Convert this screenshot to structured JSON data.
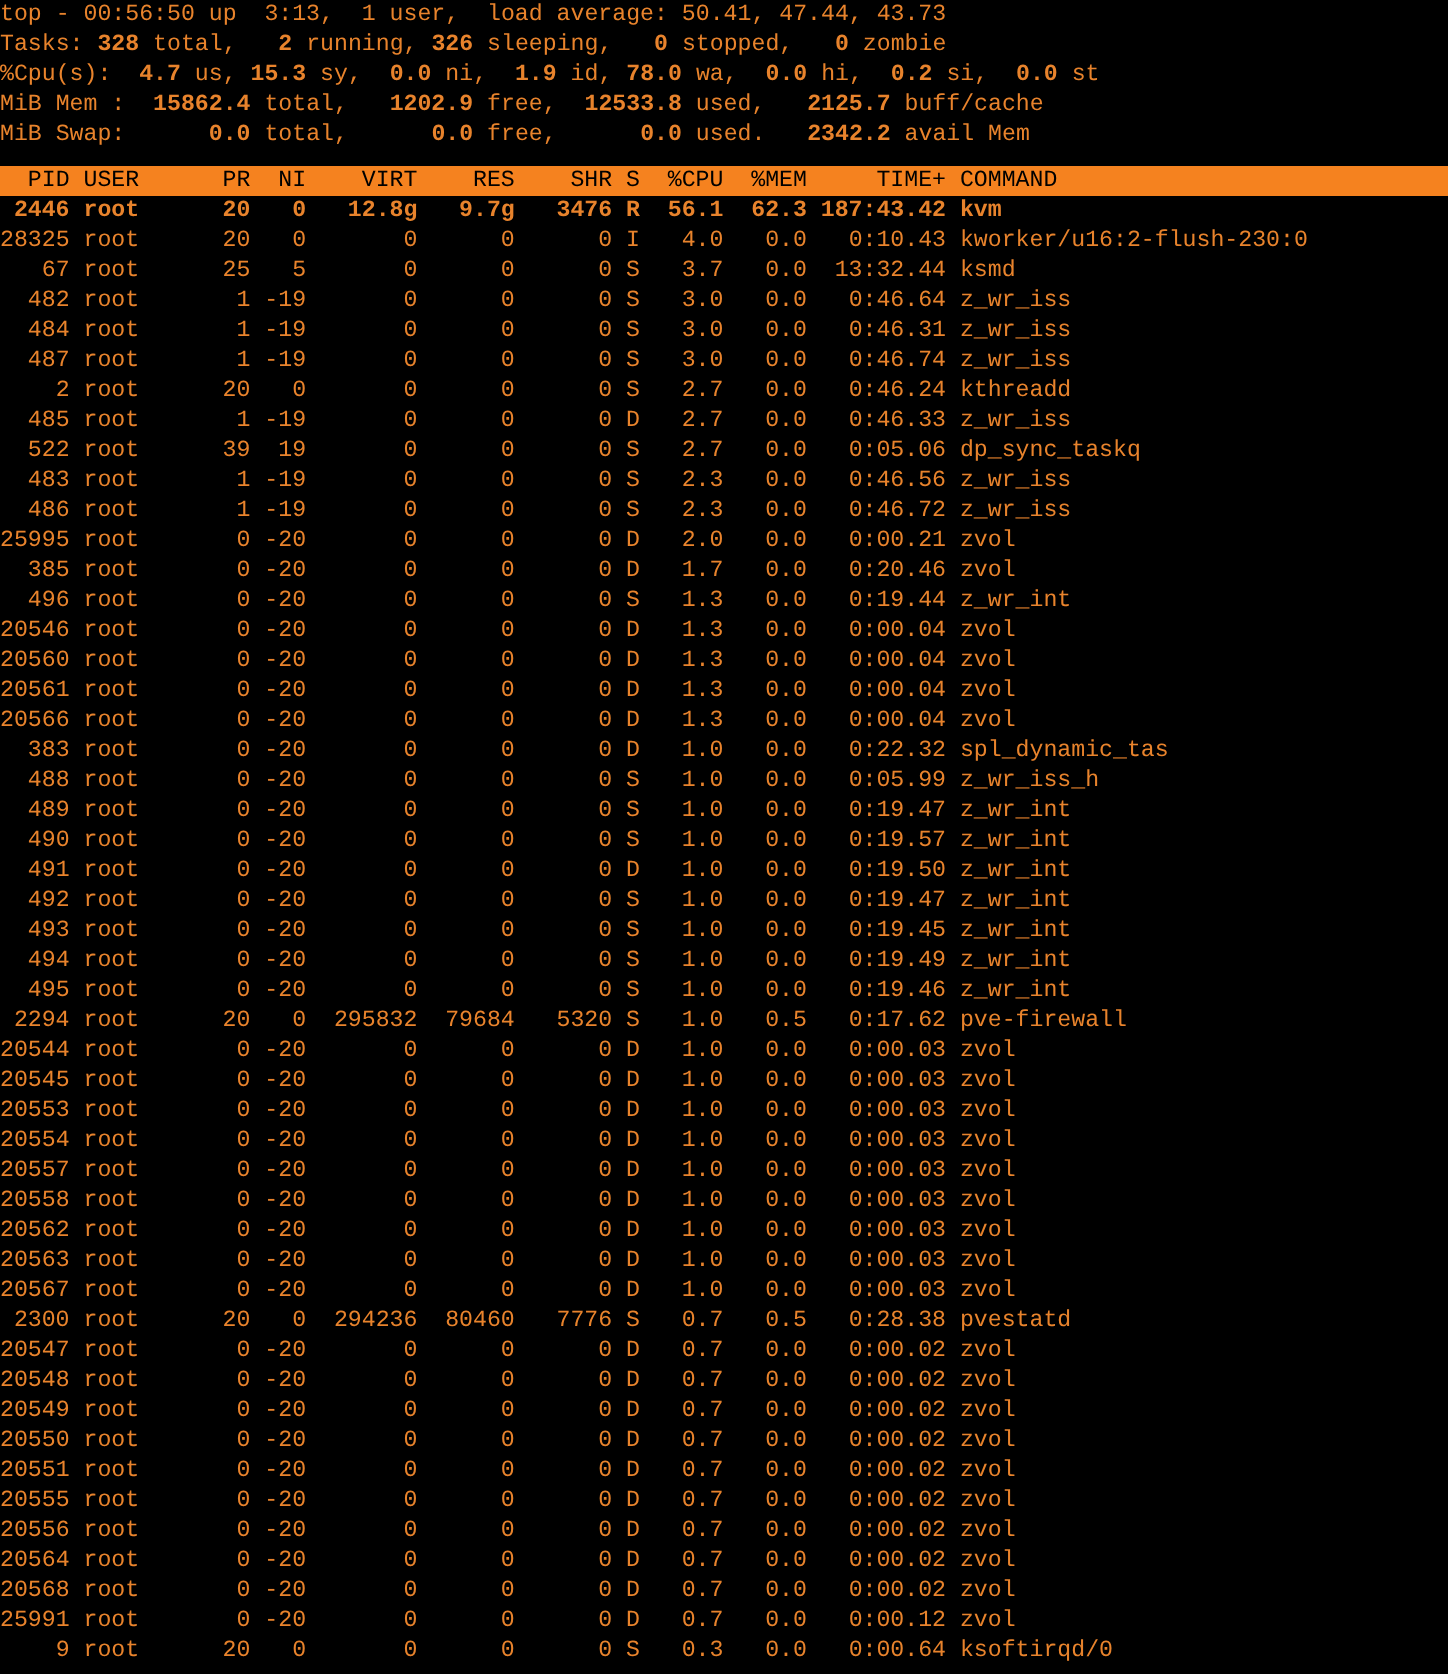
{
  "summary": [
    "top - 00:56:50 up  3:13,  1 user,  load average: 50.41, 47.44, 43.73",
    "Tasks: **328** total,   **2** running, **326** sleeping,   **0** stopped,   **0** zombie",
    "%Cpu(s):  **4.7** us, **15.3** sy,  **0.0** ni,  **1.9** id, **78.0** wa,  **0.0** hi,  **0.2** si,  **0.0** st",
    "MiB Mem :  **15862.4** total,   **1202.9** free,  **12533.8** used,   **2125.7** buff/cache",
    "MiB Swap:      **0.0** total,      **0.0** free,      **0.0** used.   **2342.2** avail Mem"
  ],
  "table": {
    "columns": [
      "PID",
      "USER",
      "PR",
      "NI",
      "VIRT",
      "RES",
      "SHR",
      "S",
      "%CPU",
      "%MEM",
      "TIME+",
      "COMMAND"
    ],
    "rows": [
      {
        "highlighted": true,
        "cells": [
          "2446",
          "root",
          "20",
          "0",
          "12.8g",
          "9.7g",
          "3476",
          "R",
          "56.1",
          "62.3",
          "187:43.42",
          "kvm"
        ]
      },
      {
        "highlighted": false,
        "cells": [
          "28325",
          "root",
          "20",
          "0",
          "0",
          "0",
          "0",
          "I",
          "4.0",
          "0.0",
          "0:10.43",
          "kworker/u16:2-flush-230:0"
        ]
      },
      {
        "highlighted": false,
        "cells": [
          "67",
          "root",
          "25",
          "5",
          "0",
          "0",
          "0",
          "S",
          "3.7",
          "0.0",
          "13:32.44",
          "ksmd"
        ]
      },
      {
        "highlighted": false,
        "cells": [
          "482",
          "root",
          "1",
          "-19",
          "0",
          "0",
          "0",
          "S",
          "3.0",
          "0.0",
          "0:46.64",
          "z_wr_iss"
        ]
      },
      {
        "highlighted": false,
        "cells": [
          "484",
          "root",
          "1",
          "-19",
          "0",
          "0",
          "0",
          "S",
          "3.0",
          "0.0",
          "0:46.31",
          "z_wr_iss"
        ]
      },
      {
        "highlighted": false,
        "cells": [
          "487",
          "root",
          "1",
          "-19",
          "0",
          "0",
          "0",
          "S",
          "3.0",
          "0.0",
          "0:46.74",
          "z_wr_iss"
        ]
      },
      {
        "highlighted": false,
        "cells": [
          "2",
          "root",
          "20",
          "0",
          "0",
          "0",
          "0",
          "S",
          "2.7",
          "0.0",
          "0:46.24",
          "kthreadd"
        ]
      },
      {
        "highlighted": false,
        "cells": [
          "485",
          "root",
          "1",
          "-19",
          "0",
          "0",
          "0",
          "D",
          "2.7",
          "0.0",
          "0:46.33",
          "z_wr_iss"
        ]
      },
      {
        "highlighted": false,
        "cells": [
          "522",
          "root",
          "39",
          "19",
          "0",
          "0",
          "0",
          "S",
          "2.7",
          "0.0",
          "0:05.06",
          "dp_sync_taskq"
        ]
      },
      {
        "highlighted": false,
        "cells": [
          "483",
          "root",
          "1",
          "-19",
          "0",
          "0",
          "0",
          "S",
          "2.3",
          "0.0",
          "0:46.56",
          "z_wr_iss"
        ]
      },
      {
        "highlighted": false,
        "cells": [
          "486",
          "root",
          "1",
          "-19",
          "0",
          "0",
          "0",
          "S",
          "2.3",
          "0.0",
          "0:46.72",
          "z_wr_iss"
        ]
      },
      {
        "highlighted": false,
        "cells": [
          "25995",
          "root",
          "0",
          "-20",
          "0",
          "0",
          "0",
          "D",
          "2.0",
          "0.0",
          "0:00.21",
          "zvol"
        ]
      },
      {
        "highlighted": false,
        "cells": [
          "385",
          "root",
          "0",
          "-20",
          "0",
          "0",
          "0",
          "D",
          "1.7",
          "0.0",
          "0:20.46",
          "zvol"
        ]
      },
      {
        "highlighted": false,
        "cells": [
          "496",
          "root",
          "0",
          "-20",
          "0",
          "0",
          "0",
          "S",
          "1.3",
          "0.0",
          "0:19.44",
          "z_wr_int"
        ]
      },
      {
        "highlighted": false,
        "cells": [
          "20546",
          "root",
          "0",
          "-20",
          "0",
          "0",
          "0",
          "D",
          "1.3",
          "0.0",
          "0:00.04",
          "zvol"
        ]
      },
      {
        "highlighted": false,
        "cells": [
          "20560",
          "root",
          "0",
          "-20",
          "0",
          "0",
          "0",
          "D",
          "1.3",
          "0.0",
          "0:00.04",
          "zvol"
        ]
      },
      {
        "highlighted": false,
        "cells": [
          "20561",
          "root",
          "0",
          "-20",
          "0",
          "0",
          "0",
          "D",
          "1.3",
          "0.0",
          "0:00.04",
          "zvol"
        ]
      },
      {
        "highlighted": false,
        "cells": [
          "20566",
          "root",
          "0",
          "-20",
          "0",
          "0",
          "0",
          "D",
          "1.3",
          "0.0",
          "0:00.04",
          "zvol"
        ]
      },
      {
        "highlighted": false,
        "cells": [
          "383",
          "root",
          "0",
          "-20",
          "0",
          "0",
          "0",
          "D",
          "1.0",
          "0.0",
          "0:22.32",
          "spl_dynamic_tas"
        ]
      },
      {
        "highlighted": false,
        "cells": [
          "488",
          "root",
          "0",
          "-20",
          "0",
          "0",
          "0",
          "S",
          "1.0",
          "0.0",
          "0:05.99",
          "z_wr_iss_h"
        ]
      },
      {
        "highlighted": false,
        "cells": [
          "489",
          "root",
          "0",
          "-20",
          "0",
          "0",
          "0",
          "S",
          "1.0",
          "0.0",
          "0:19.47",
          "z_wr_int"
        ]
      },
      {
        "highlighted": false,
        "cells": [
          "490",
          "root",
          "0",
          "-20",
          "0",
          "0",
          "0",
          "S",
          "1.0",
          "0.0",
          "0:19.57",
          "z_wr_int"
        ]
      },
      {
        "highlighted": false,
        "cells": [
          "491",
          "root",
          "0",
          "-20",
          "0",
          "0",
          "0",
          "D",
          "1.0",
          "0.0",
          "0:19.50",
          "z_wr_int"
        ]
      },
      {
        "highlighted": false,
        "cells": [
          "492",
          "root",
          "0",
          "-20",
          "0",
          "0",
          "0",
          "S",
          "1.0",
          "0.0",
          "0:19.47",
          "z_wr_int"
        ]
      },
      {
        "highlighted": false,
        "cells": [
          "493",
          "root",
          "0",
          "-20",
          "0",
          "0",
          "0",
          "S",
          "1.0",
          "0.0",
          "0:19.45",
          "z_wr_int"
        ]
      },
      {
        "highlighted": false,
        "cells": [
          "494",
          "root",
          "0",
          "-20",
          "0",
          "0",
          "0",
          "S",
          "1.0",
          "0.0",
          "0:19.49",
          "z_wr_int"
        ]
      },
      {
        "highlighted": false,
        "cells": [
          "495",
          "root",
          "0",
          "-20",
          "0",
          "0",
          "0",
          "S",
          "1.0",
          "0.0",
          "0:19.46",
          "z_wr_int"
        ]
      },
      {
        "highlighted": false,
        "cells": [
          "2294",
          "root",
          "20",
          "0",
          "295832",
          "79684",
          "5320",
          "S",
          "1.0",
          "0.5",
          "0:17.62",
          "pve-firewall"
        ]
      },
      {
        "highlighted": false,
        "cells": [
          "20544",
          "root",
          "0",
          "-20",
          "0",
          "0",
          "0",
          "D",
          "1.0",
          "0.0",
          "0:00.03",
          "zvol"
        ]
      },
      {
        "highlighted": false,
        "cells": [
          "20545",
          "root",
          "0",
          "-20",
          "0",
          "0",
          "0",
          "D",
          "1.0",
          "0.0",
          "0:00.03",
          "zvol"
        ]
      },
      {
        "highlighted": false,
        "cells": [
          "20553",
          "root",
          "0",
          "-20",
          "0",
          "0",
          "0",
          "D",
          "1.0",
          "0.0",
          "0:00.03",
          "zvol"
        ]
      },
      {
        "highlighted": false,
        "cells": [
          "20554",
          "root",
          "0",
          "-20",
          "0",
          "0",
          "0",
          "D",
          "1.0",
          "0.0",
          "0:00.03",
          "zvol"
        ]
      },
      {
        "highlighted": false,
        "cells": [
          "20557",
          "root",
          "0",
          "-20",
          "0",
          "0",
          "0",
          "D",
          "1.0",
          "0.0",
          "0:00.03",
          "zvol"
        ]
      },
      {
        "highlighted": false,
        "cells": [
          "20558",
          "root",
          "0",
          "-20",
          "0",
          "0",
          "0",
          "D",
          "1.0",
          "0.0",
          "0:00.03",
          "zvol"
        ]
      },
      {
        "highlighted": false,
        "cells": [
          "20562",
          "root",
          "0",
          "-20",
          "0",
          "0",
          "0",
          "D",
          "1.0",
          "0.0",
          "0:00.03",
          "zvol"
        ]
      },
      {
        "highlighted": false,
        "cells": [
          "20563",
          "root",
          "0",
          "-20",
          "0",
          "0",
          "0",
          "D",
          "1.0",
          "0.0",
          "0:00.03",
          "zvol"
        ]
      },
      {
        "highlighted": false,
        "cells": [
          "20567",
          "root",
          "0",
          "-20",
          "0",
          "0",
          "0",
          "D",
          "1.0",
          "0.0",
          "0:00.03",
          "zvol"
        ]
      },
      {
        "highlighted": false,
        "cells": [
          "2300",
          "root",
          "20",
          "0",
          "294236",
          "80460",
          "7776",
          "S",
          "0.7",
          "0.5",
          "0:28.38",
          "pvestatd"
        ]
      },
      {
        "highlighted": false,
        "cells": [
          "20547",
          "root",
          "0",
          "-20",
          "0",
          "0",
          "0",
          "D",
          "0.7",
          "0.0",
          "0:00.02",
          "zvol"
        ]
      },
      {
        "highlighted": false,
        "cells": [
          "20548",
          "root",
          "0",
          "-20",
          "0",
          "0",
          "0",
          "D",
          "0.7",
          "0.0",
          "0:00.02",
          "zvol"
        ]
      },
      {
        "highlighted": false,
        "cells": [
          "20549",
          "root",
          "0",
          "-20",
          "0",
          "0",
          "0",
          "D",
          "0.7",
          "0.0",
          "0:00.02",
          "zvol"
        ]
      },
      {
        "highlighted": false,
        "cells": [
          "20550",
          "root",
          "0",
          "-20",
          "0",
          "0",
          "0",
          "D",
          "0.7",
          "0.0",
          "0:00.02",
          "zvol"
        ]
      },
      {
        "highlighted": false,
        "cells": [
          "20551",
          "root",
          "0",
          "-20",
          "0",
          "0",
          "0",
          "D",
          "0.7",
          "0.0",
          "0:00.02",
          "zvol"
        ]
      },
      {
        "highlighted": false,
        "cells": [
          "20555",
          "root",
          "0",
          "-20",
          "0",
          "0",
          "0",
          "D",
          "0.7",
          "0.0",
          "0:00.02",
          "zvol"
        ]
      },
      {
        "highlighted": false,
        "cells": [
          "20556",
          "root",
          "0",
          "-20",
          "0",
          "0",
          "0",
          "D",
          "0.7",
          "0.0",
          "0:00.02",
          "zvol"
        ]
      },
      {
        "highlighted": false,
        "cells": [
          "20564",
          "root",
          "0",
          "-20",
          "0",
          "0",
          "0",
          "D",
          "0.7",
          "0.0",
          "0:00.02",
          "zvol"
        ]
      },
      {
        "highlighted": false,
        "cells": [
          "20568",
          "root",
          "0",
          "-20",
          "0",
          "0",
          "0",
          "D",
          "0.7",
          "0.0",
          "0:00.02",
          "zvol"
        ]
      },
      {
        "highlighted": false,
        "cells": [
          "25991",
          "root",
          "0",
          "-20",
          "0",
          "0",
          "0",
          "D",
          "0.7",
          "0.0",
          "0:00.12",
          "zvol"
        ]
      },
      {
        "highlighted": false,
        "cells": [
          "9",
          "root",
          "20",
          "0",
          "0",
          "0",
          "0",
          "S",
          "0.3",
          "0.0",
          "0:00.64",
          "ksoftirqd/0"
        ]
      }
    ]
  }
}
